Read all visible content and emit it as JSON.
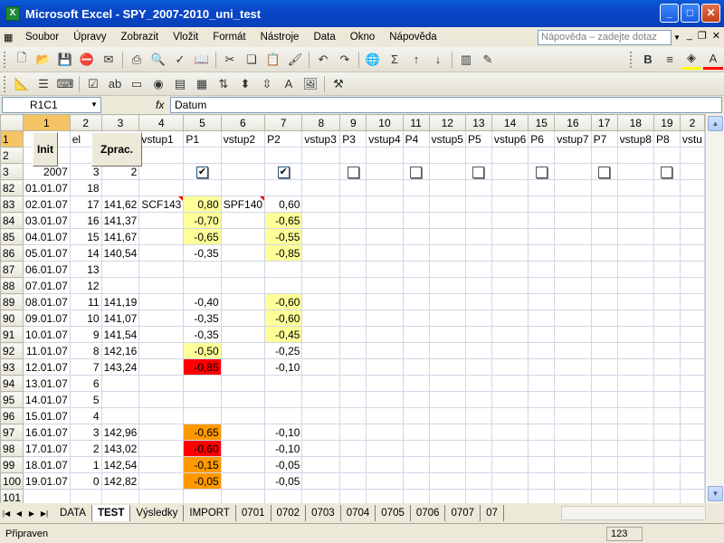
{
  "window": {
    "title": "Microsoft Excel - SPY_2007-2010_uni_test",
    "app_icon": "X"
  },
  "menu": [
    "Soubor",
    "Úpravy",
    "Zobrazit",
    "Vložit",
    "Formát",
    "Nástroje",
    "Data",
    "Okno",
    "Nápověda"
  ],
  "help_placeholder": "Nápověda – zadejte dotaz",
  "namebox": "R1C1",
  "fx": "fx",
  "formula": "Datum",
  "buttons": {
    "init": "Init",
    "zprac": "Zprac."
  },
  "columns": [
    "1",
    "2",
    "3",
    "4",
    "5",
    "6",
    "7",
    "8",
    "9",
    "10",
    "11",
    "12",
    "13",
    "14",
    "15",
    "16",
    "17",
    "18",
    "19",
    "2"
  ],
  "rows": [
    {
      "n": "1",
      "cells": [
        "",
        "el",
        "",
        "vstup1",
        "P1",
        "vstup2",
        "P2",
        "vstup3",
        "P3",
        "vstup4",
        "P4",
        "vstup5",
        "P5",
        "vstup6",
        "P6",
        "vstup7",
        "P7",
        "vstup8",
        "P8",
        "vstu"
      ]
    },
    {
      "n": "2",
      "cells": [
        "",
        "",
        "",
        "",
        "",
        "",
        "",
        "",
        "",
        "",
        "",
        "",
        "",
        "",
        "",
        "",
        "",
        "",
        "",
        ""
      ]
    },
    {
      "n": "3",
      "cells": [
        "2007",
        "3",
        "2",
        "",
        "[x]",
        "",
        "[x]",
        "",
        "[ ]",
        "",
        "[ ]",
        "",
        "[ ]",
        "",
        "[ ]",
        "",
        "[ ]",
        "",
        "[ ]",
        ""
      ]
    },
    {
      "n": "82",
      "cells": [
        "01.01.07",
        "18",
        "",
        "",
        "",
        "",
        "",
        "",
        "",
        "",
        "",
        "",
        "",
        "",
        "",
        "",
        "",
        "",
        "",
        ""
      ]
    },
    {
      "n": "83",
      "cells": [
        "02.01.07",
        "17",
        "141,62",
        "SCF143",
        "0,80",
        "SPF140",
        "0,60",
        "",
        "",
        "",
        "",
        "",
        "",
        "",
        "",
        "",
        "",
        "",
        "",
        ""
      ]
    },
    {
      "n": "84",
      "cells": [
        "03.01.07",
        "16",
        "141,37",
        "",
        "-0,70",
        "",
        "-0,65",
        "",
        "",
        "",
        "",
        "",
        "",
        "",
        "",
        "",
        "",
        "",
        "",
        ""
      ]
    },
    {
      "n": "85",
      "cells": [
        "04.01.07",
        "15",
        "141,67",
        "",
        "-0,65",
        "",
        "-0,55",
        "",
        "",
        "",
        "",
        "",
        "",
        "",
        "",
        "",
        "",
        "",
        "",
        ""
      ]
    },
    {
      "n": "86",
      "cells": [
        "05.01.07",
        "14",
        "140,54",
        "",
        "-0,35",
        "",
        "-0,85",
        "",
        "",
        "",
        "",
        "",
        "",
        "",
        "",
        "",
        "",
        "",
        "",
        ""
      ]
    },
    {
      "n": "87",
      "cells": [
        "06.01.07",
        "13",
        "",
        "",
        "",
        "",
        "",
        "",
        "",
        "",
        "",
        "",
        "",
        "",
        "",
        "",
        "",
        "",
        "",
        ""
      ]
    },
    {
      "n": "88",
      "cells": [
        "07.01.07",
        "12",
        "",
        "",
        "",
        "",
        "",
        "",
        "",
        "",
        "",
        "",
        "",
        "",
        "",
        "",
        "",
        "",
        "",
        ""
      ]
    },
    {
      "n": "89",
      "cells": [
        "08.01.07",
        "11",
        "141,19",
        "",
        "-0,40",
        "",
        "-0,60",
        "",
        "",
        "",
        "",
        "",
        "",
        "",
        "",
        "",
        "",
        "",
        "",
        ""
      ]
    },
    {
      "n": "90",
      "cells": [
        "09.01.07",
        "10",
        "141,07",
        "",
        "-0,35",
        "",
        "-0,60",
        "",
        "",
        "",
        "",
        "",
        "",
        "",
        "",
        "",
        "",
        "",
        "",
        ""
      ]
    },
    {
      "n": "91",
      "cells": [
        "10.01.07",
        "9",
        "141,54",
        "",
        "-0,35",
        "",
        "-0,45",
        "",
        "",
        "",
        "",
        "",
        "",
        "",
        "",
        "",
        "",
        "",
        "",
        ""
      ]
    },
    {
      "n": "92",
      "cells": [
        "11.01.07",
        "8",
        "142,16",
        "",
        "-0,50",
        "",
        "-0,25",
        "",
        "",
        "",
        "",
        "",
        "",
        "",
        "",
        "",
        "",
        "",
        "",
        ""
      ]
    },
    {
      "n": "93",
      "cells": [
        "12.01.07",
        "7",
        "143,24",
        "",
        "-0,85",
        "",
        "-0,10",
        "",
        "",
        "",
        "",
        "",
        "",
        "",
        "",
        "",
        "",
        "",
        "",
        ""
      ]
    },
    {
      "n": "94",
      "cells": [
        "13.01.07",
        "6",
        "",
        "",
        "",
        "",
        "",
        "",
        "",
        "",
        "",
        "",
        "",
        "",
        "",
        "",
        "",
        "",
        "",
        ""
      ]
    },
    {
      "n": "95",
      "cells": [
        "14.01.07",
        "5",
        "",
        "",
        "",
        "",
        "",
        "",
        "",
        "",
        "",
        "",
        "",
        "",
        "",
        "",
        "",
        "",
        "",
        ""
      ]
    },
    {
      "n": "96",
      "cells": [
        "15.01.07",
        "4",
        "",
        "",
        "",
        "",
        "",
        "",
        "",
        "",
        "",
        "",
        "",
        "",
        "",
        "",
        "",
        "",
        "",
        ""
      ]
    },
    {
      "n": "97",
      "cells": [
        "16.01.07",
        "3",
        "142,96",
        "",
        "-0,65",
        "",
        "-0,10",
        "",
        "",
        "",
        "",
        "",
        "",
        "",
        "",
        "",
        "",
        "",
        "",
        ""
      ]
    },
    {
      "n": "98",
      "cells": [
        "17.01.07",
        "2",
        "143,02",
        "",
        "-0,60",
        "",
        "-0,10",
        "",
        "",
        "",
        "",
        "",
        "",
        "",
        "",
        "",
        "",
        "",
        "",
        ""
      ]
    },
    {
      "n": "99",
      "cells": [
        "18.01.07",
        "1",
        "142,54",
        "",
        "-0,15",
        "",
        "-0,05",
        "",
        "",
        "",
        "",
        "",
        "",
        "",
        "",
        "",
        "",
        "",
        "",
        ""
      ]
    },
    {
      "n": "100",
      "cells": [
        "19.01.07",
        "0",
        "142,82",
        "",
        "-0,05",
        "",
        "-0,05",
        "",
        "",
        "",
        "",
        "",
        "",
        "",
        "",
        "",
        "",
        "",
        "",
        ""
      ]
    },
    {
      "n": "101",
      "cells": [
        "",
        "",
        "",
        "",
        "",
        "",
        "",
        "",
        "",
        "",
        "",
        "",
        "",
        "",
        "",
        "",
        "",
        "",
        "",
        ""
      ]
    },
    {
      "n": "102",
      "cells": [
        "",
        "",
        "",
        "",
        "",
        "",
        "",
        "",
        "",
        "",
        "",
        "",
        "",
        "",
        "",
        "",
        "",
        "",
        "",
        ""
      ]
    },
    {
      "n": "103",
      "cells": [
        "",
        "",
        "",
        "",
        "",
        "",
        "",
        "",
        "",
        "",
        "",
        "",
        "",
        "",
        "",
        "",
        "",
        "",
        "",
        ""
      ]
    }
  ],
  "highlights": {
    "83": {
      "4": "yel"
    },
    "84": {
      "4": "yel",
      "6": "yel"
    },
    "85": {
      "4": "yel",
      "6": "yel"
    },
    "86": {
      "6": "yel"
    },
    "89": {
      "6": "yel"
    },
    "90": {
      "6": "yel"
    },
    "91": {
      "6": "yel"
    },
    "92": {
      "4": "yel"
    },
    "93": {
      "4": "red"
    },
    "97": {
      "4": "org"
    },
    "98": {
      "4": "red"
    },
    "99": {
      "4": "org"
    },
    "100": {
      "4": "org"
    }
  },
  "colors": {
    "yel": "#ffff99",
    "red": "#ff0000",
    "org": "#ff9900"
  },
  "sheets": [
    "DATA",
    "TEST",
    "Výsledky",
    "IMPORT",
    "0701",
    "0702",
    "0703",
    "0704",
    "0705",
    "0706",
    "0707",
    "07"
  ],
  "active_sheet": "TEST",
  "status": {
    "ready": "Připraven",
    "num": "123"
  }
}
